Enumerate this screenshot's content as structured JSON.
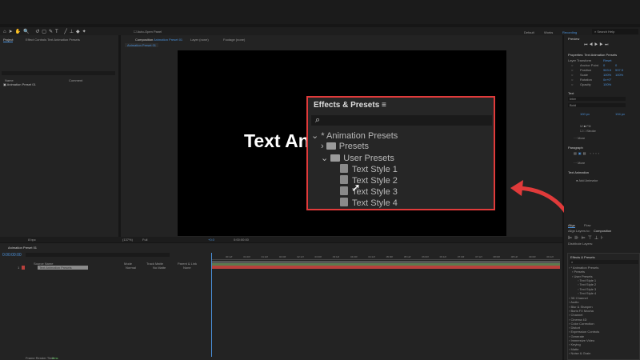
{
  "toolbar": {
    "auto_open_panel": "Auto-Open Panel",
    "workspaces": [
      "Default",
      "Works",
      "Recording"
    ],
    "search_placeholder": "Search Help"
  },
  "project_panel": {
    "tab_project": "Project",
    "tab_effect_controls": "Effect Controls Text Animation Presets",
    "col_name": "Name",
    "col_comment": "Comment",
    "items": [
      "Animation Preset 01"
    ]
  },
  "comp_panel": {
    "tab_composition": "Composition",
    "comp_name": "Animation Preset 01",
    "tab_layer": "Layer (none)",
    "tab_footage": "Footage (none)",
    "breadcrumb": "Animation Preset 01",
    "canvas_text": "Text An",
    "zoom": "(137%)",
    "quality": "Full",
    "exposure": "+0.0",
    "timecode": "0:00:00:00",
    "bits": "8 bpc"
  },
  "popup": {
    "title": "Effects & Presets",
    "tree": [
      {
        "label": "* Animation Presets",
        "level": 0,
        "type": "group"
      },
      {
        "label": "Presets",
        "level": 1,
        "type": "folder"
      },
      {
        "label": "User Presets",
        "level": 1,
        "type": "folder"
      },
      {
        "label": "Text Style 1",
        "level": 2,
        "type": "preset"
      },
      {
        "label": "Text Style 2",
        "level": 2,
        "type": "preset"
      },
      {
        "label": "Text Style 3",
        "level": 2,
        "type": "preset"
      },
      {
        "label": "Text Style 4",
        "level": 2,
        "type": "preset"
      }
    ]
  },
  "preview": {
    "title": "Preview"
  },
  "properties": {
    "title": "Properties: Text Animation Presets",
    "layer_transform": "Layer Transform",
    "reset": "Reset",
    "rows": [
      {
        "label": "Anchor Point",
        "v1": "0",
        "v2": "0"
      },
      {
        "label": "Position",
        "v1": "963.6",
        "v2": "537.5"
      },
      {
        "label": "Scale",
        "v1": "100%",
        "v2": "100%"
      },
      {
        "label": "Rotation",
        "v1": "0x+0°",
        "v2": ""
      },
      {
        "label": "Opacity",
        "v1": "100%",
        "v2": ""
      }
    ]
  },
  "text_panel": {
    "title": "Text",
    "font": "Inter",
    "style": "Bold",
    "size": "100 px",
    "leading": "134 px",
    "fill": "Fill",
    "stroke": "Stroke",
    "more": "More"
  },
  "paragraph": {
    "title": "Paragraph",
    "more": "More"
  },
  "text_animation": {
    "title": "Text Animation",
    "add_animator": "Add Animator"
  },
  "align": {
    "tab_align": "Align",
    "tab_flow": "Flow",
    "align_to_label": "Align Layers to:",
    "align_to": "Composition",
    "distribute": "Distribute Layers:"
  },
  "effects_panel": {
    "title": "Effects & Presets",
    "tree": [
      "* Animation Presets",
      "Presets",
      "User Presets",
      "Text Style 1",
      "Text Style 2",
      "Text Style 3",
      "Text Style 4"
    ],
    "categories": [
      "3D Channel",
      "Audio",
      "Blur & Sharpen",
      "Boris FX Mocha",
      "Channel",
      "Cinema 4D",
      "Color Correction",
      "Distort",
      "Expression Controls",
      "Generate",
      "Immersive Video",
      "Keying",
      "Matte",
      "Noise & Grain"
    ]
  },
  "timeline": {
    "tab": "Animation Preset 01",
    "timecode": "0:00:00:00",
    "col_source": "Source Name",
    "col_mode": "Mode",
    "col_trkmat": "Track Matte",
    "col_parent": "Parent & Link",
    "layer": {
      "num": "1",
      "name": "Text Animation Presets",
      "mode": "Normal",
      "matte": "No Matte",
      "parent": "None"
    },
    "ruler": [
      "00:12f",
      "01:00f",
      "01:12f",
      "02:00f",
      "02:12f",
      "03:00f",
      "03:12f",
      "04:00f",
      "04:12f",
      "05:00f",
      "05:12f",
      "06:00f",
      "06:12f",
      "07:00f",
      "07:12f",
      "08:00f",
      "08:12f",
      "09:00f",
      "09:12f"
    ],
    "render_time_label": "Frame Render Time",
    "render_time": "0ms"
  },
  "colors": {
    "accent": "#4a90d9",
    "highlight": "#e03a3a",
    "track_green": "#5c7a4e",
    "track_red": "#b8403c"
  }
}
